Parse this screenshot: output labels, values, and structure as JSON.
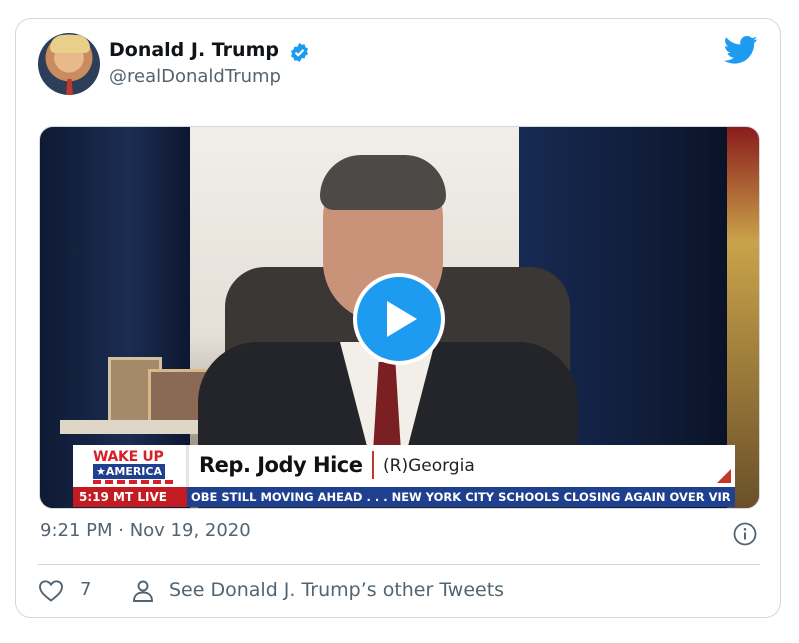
{
  "tweet": {
    "author_name": "Donald J. Trump",
    "handle": "@realDonaldTrump",
    "verified": true,
    "timestamp": "9:21 PM · Nov 19, 2020",
    "likes": "7",
    "see_more": "See Donald J. Trump’s other Tweets"
  },
  "video": {
    "bug_line1": "WAKE UP",
    "bug_line2": "★AMERICA",
    "guest_name": "Rep. Jody Hice",
    "guest_party": "(R)Georgia",
    "ticker_time": "5:19 MT  LIVE",
    "ticker_text": "OBE STILL MOVING AHEAD . . .     NEW YORK CITY SCHOOLS CLOSING AGAIN OVER VIRU"
  },
  "colors": {
    "twitter_blue": "#1d9bf0",
    "text_secondary": "#536471",
    "border": "#cfd9de"
  },
  "icons": [
    "verified-badge-icon",
    "twitter-bird-icon",
    "play-icon",
    "info-icon",
    "heart-icon",
    "person-icon"
  ]
}
